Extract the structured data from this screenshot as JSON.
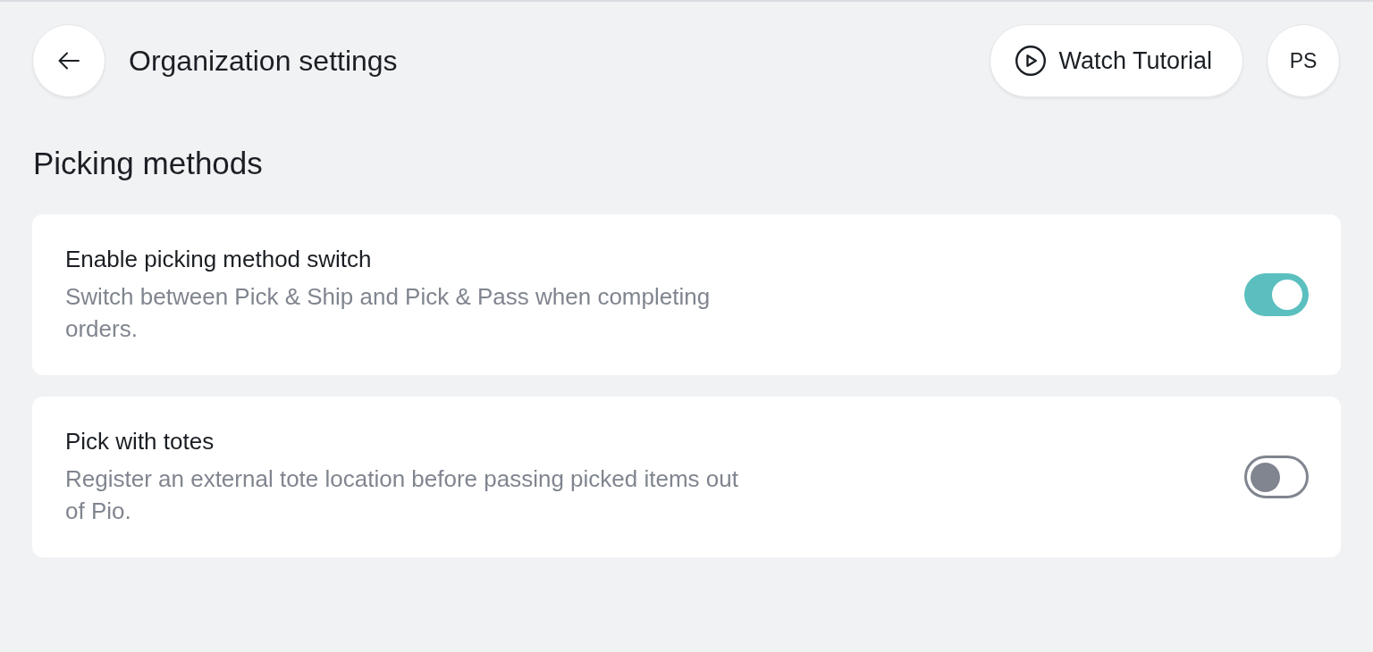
{
  "header": {
    "title": "Organization settings",
    "tutorial_button": "Watch Tutorial",
    "avatar": "PS"
  },
  "section": {
    "title": "Picking methods",
    "settings": [
      {
        "title": "Enable picking method switch",
        "description": "Switch between Pick & Ship and Pick & Pass when completing orders.",
        "on": true
      },
      {
        "title": "Pick with totes",
        "description": "Register an external tote location before passing picked items out of Pio.",
        "on": false
      }
    ]
  }
}
